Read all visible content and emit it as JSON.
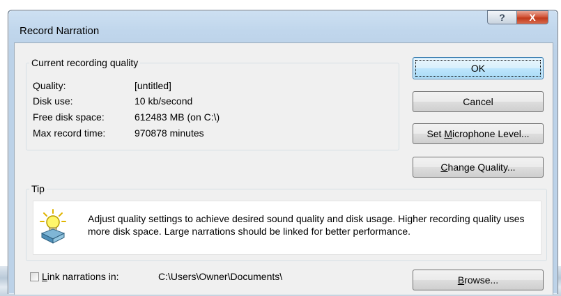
{
  "window": {
    "title": "Record Narration",
    "help_label": "?",
    "close_label": "X"
  },
  "quality_group": {
    "label": "Current recording quality",
    "rows": [
      {
        "label": "Quality:",
        "value": "[untitled]"
      },
      {
        "label": "Disk use:",
        "value": "10 kb/second"
      },
      {
        "label": "Free disk space:",
        "value": "612483 MB (on C:\\)"
      },
      {
        "label": "Max record time:",
        "value": "970878 minutes"
      }
    ]
  },
  "buttons": {
    "ok": "OK",
    "cancel": "Cancel",
    "set_mic": {
      "before": "Set ",
      "mnemonic": "M",
      "after": "icrophone Level..."
    },
    "change_quality": {
      "mnemonic": "C",
      "after": "hange Quality..."
    },
    "browse": {
      "mnemonic": "B",
      "after": "rowse..."
    }
  },
  "tip": {
    "label": "Tip",
    "icon": "lightbulb-tip-icon",
    "text": "Adjust quality settings to achieve desired sound quality and disk usage. Higher recording quality uses more disk space. Large narrations should be linked for better performance."
  },
  "link": {
    "checked": false,
    "label_mnemonic": "L",
    "label_rest": "ink narrations in:",
    "path": "C:\\Users\\Owner\\Documents\\"
  }
}
